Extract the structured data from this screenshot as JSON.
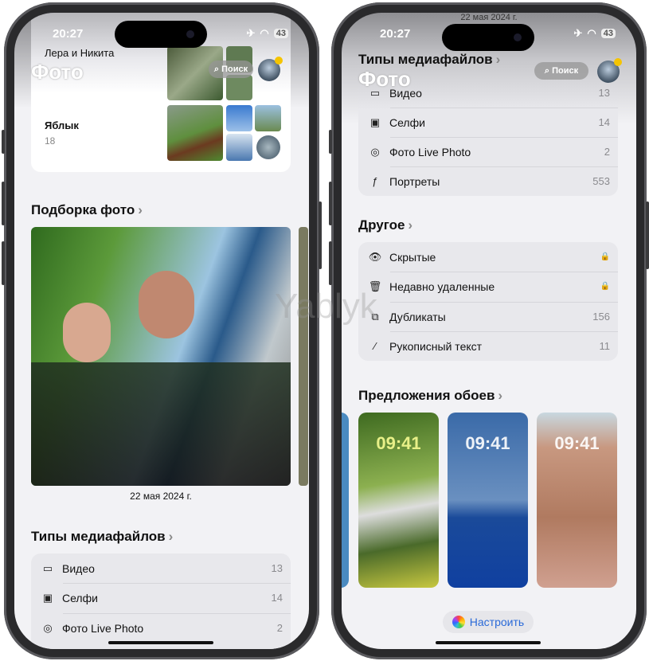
{
  "status_bar": {
    "time": "20:27",
    "battery": "43"
  },
  "header": {
    "title": "Фото",
    "search_label": "Поиск"
  },
  "left": {
    "collections": [
      {
        "name": "Лера и Никита"
      },
      {
        "name": "Яблык",
        "count": "18"
      }
    ],
    "featured": {
      "heading": "Подборка фото",
      "date": "22 мая 2024 г."
    },
    "media_types": {
      "heading": "Типы медиафайлов",
      "items": [
        {
          "icon": "video-icon",
          "label": "Видео",
          "count": "13"
        },
        {
          "icon": "selfie-icon",
          "label": "Селфи",
          "count": "14"
        },
        {
          "icon": "live-photo-icon",
          "label": "Фото Live Photo",
          "count": "2"
        }
      ]
    }
  },
  "right": {
    "top_date": "22 мая 2024 г.",
    "media_types": {
      "heading": "Типы медиафайлов",
      "items": [
        {
          "icon": "video-icon",
          "label": "Видео",
          "count": "13"
        },
        {
          "icon": "selfie-icon",
          "label": "Селфи",
          "count": "14"
        },
        {
          "icon": "live-photo-icon",
          "label": "Фото Live Photo",
          "count": "2"
        },
        {
          "icon": "portrait-icon",
          "label": "Портреты",
          "count": "553"
        }
      ]
    },
    "other": {
      "heading": "Другое",
      "items": [
        {
          "icon": "hidden-icon",
          "label": "Скрытые",
          "count": "🔒"
        },
        {
          "icon": "trash-icon",
          "label": "Недавно удаленные",
          "count": "🔒"
        },
        {
          "icon": "duplicates-icon",
          "label": "Дубликаты",
          "count": "156"
        },
        {
          "icon": "handwriting-icon",
          "label": "Рукописный текст",
          "count": "11"
        }
      ]
    },
    "wallpapers": {
      "heading": "Предложения обоев",
      "clock": "09:41"
    },
    "customize_label": "Настроить"
  },
  "watermark": "Yablyk"
}
